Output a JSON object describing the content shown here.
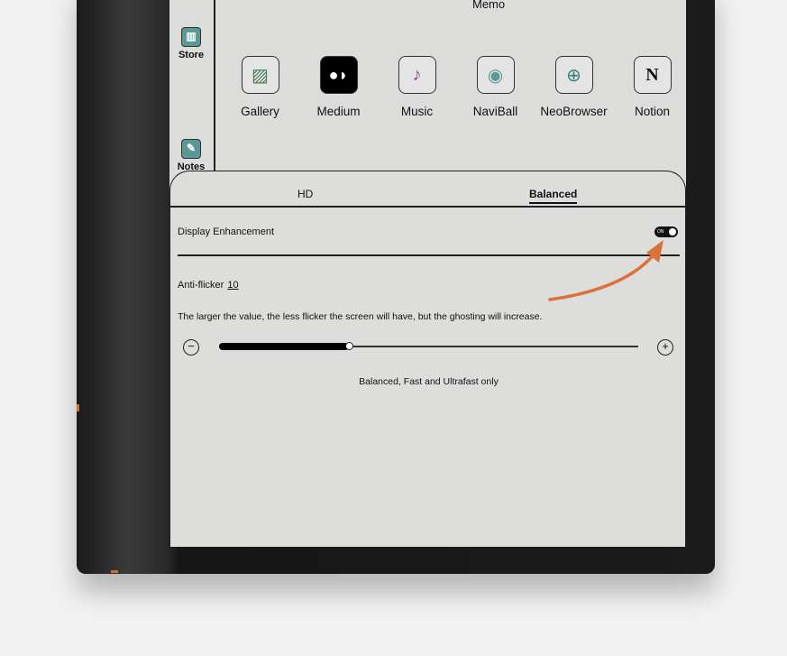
{
  "sidebar": {
    "items": [
      {
        "label": "Store",
        "icon": "store-icon"
      },
      {
        "label": "Notes",
        "icon": "notes-icon"
      }
    ]
  },
  "home": {
    "section_label": "Memo",
    "apps": [
      {
        "label": "Gallery",
        "icon": "gallery-icon"
      },
      {
        "label": "Medium",
        "icon": "medium-icon"
      },
      {
        "label": "Music",
        "icon": "music-icon"
      },
      {
        "label": "NaviBall",
        "icon": "naviball-icon"
      },
      {
        "label": "NeoBrowser",
        "icon": "globe-icon"
      },
      {
        "label": "Notion",
        "icon": "notion-icon"
      }
    ]
  },
  "panel": {
    "tabs": [
      {
        "label": "HD",
        "active": false
      },
      {
        "label": "Balanced",
        "active": true
      }
    ],
    "display_enhancement": {
      "label": "Display Enhancement",
      "toggle_text": "ON",
      "on": true
    },
    "anti_flicker": {
      "label": "Anti-flicker",
      "value": "10",
      "slider_fraction": 0.31
    },
    "description": "The larger the value, the less flicker the screen will have, but the ghosting will increase.",
    "note": "Balanced, Fast and Ultrafast only"
  },
  "colors": {
    "annotation_arrow": "#d9733a",
    "icon_teal": "#5a9896"
  }
}
